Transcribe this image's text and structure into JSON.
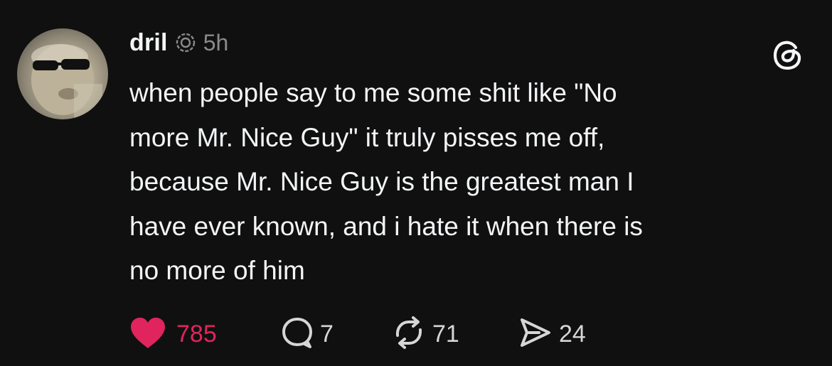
{
  "post": {
    "username": "dril",
    "timestamp": "5h",
    "text_lines": [
      "when people say to me some shit like \"No",
      "more Mr. Nice Guy\" it truly pisses me off,",
      "because Mr. Nice Guy is the greatest man I",
      "have ever known, and i hate it when there is",
      "no more of him"
    ]
  },
  "actions": {
    "likes": "785",
    "replies": "7",
    "reposts": "71",
    "shares": "24"
  },
  "colors": {
    "background": "#101010",
    "text": "#f3f5f7",
    "muted": "#8a8a8a",
    "like_red": "#e0245e"
  },
  "icons": {
    "verified": "verified-badge-icon",
    "brand": "threads-logo-icon",
    "like": "heart-filled-icon",
    "reply": "speech-bubble-icon",
    "repost": "repost-arrows-icon",
    "share": "send-icon"
  }
}
